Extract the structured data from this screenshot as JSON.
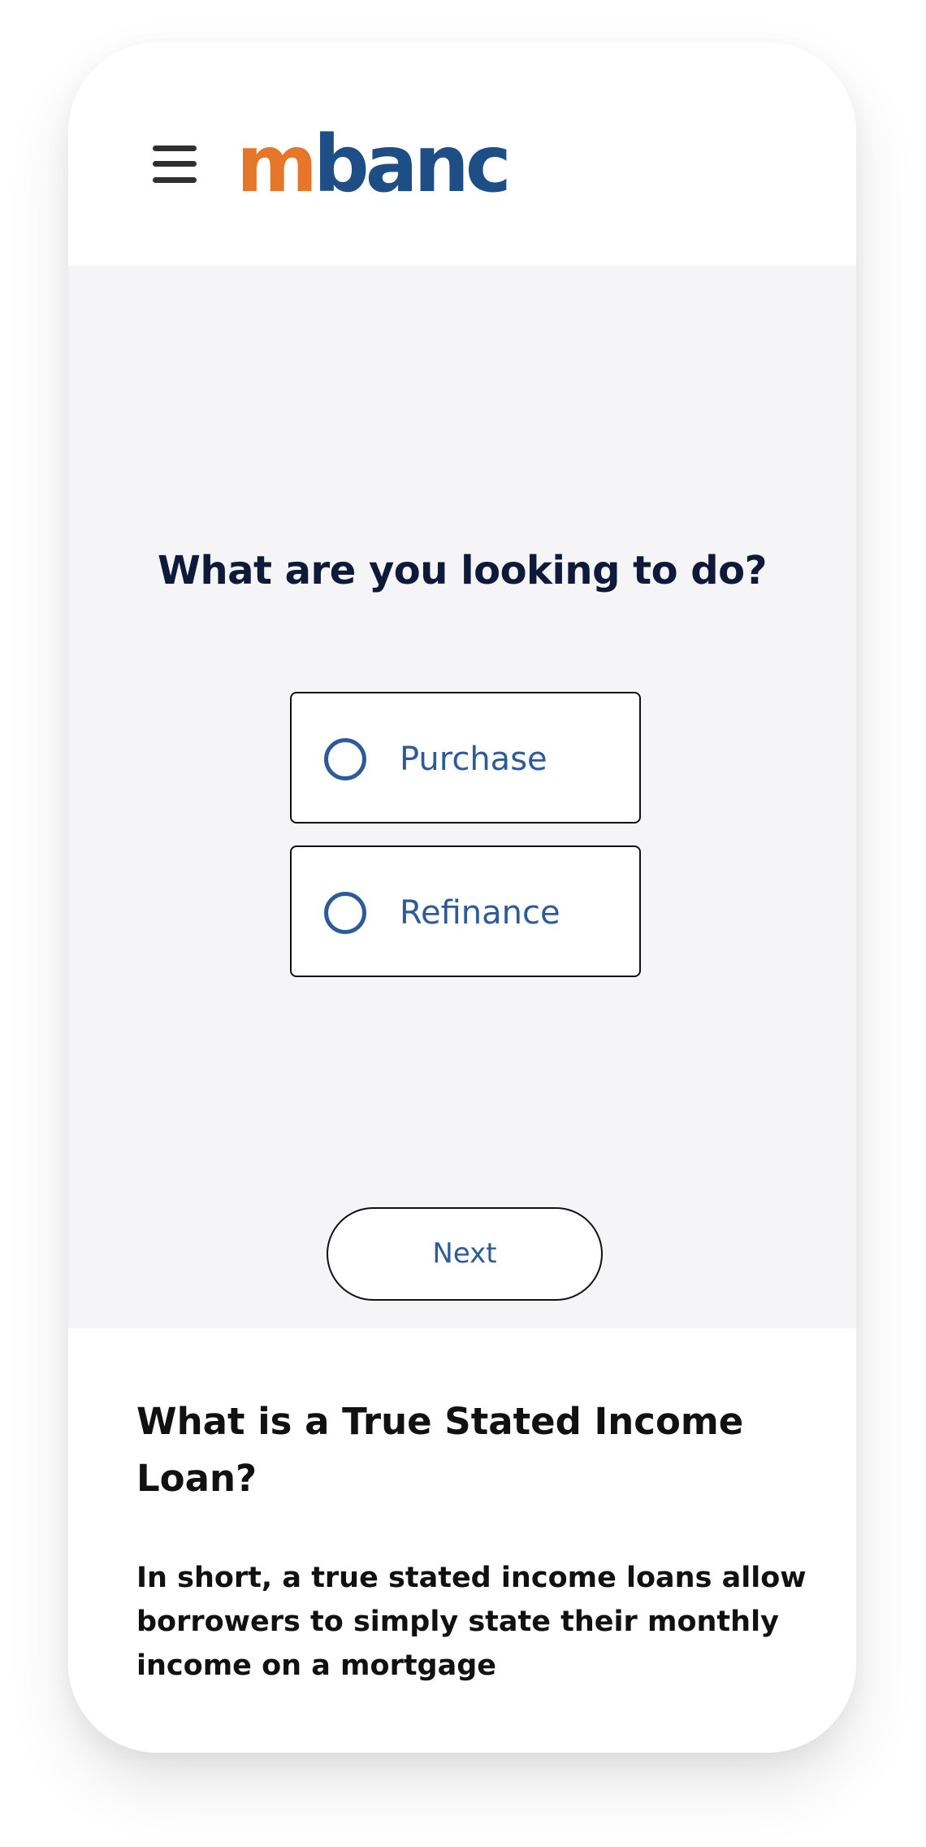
{
  "header": {
    "menu_icon": "hamburger-menu-icon",
    "logo": {
      "part1": "m",
      "part2": "banc",
      "colors": {
        "m": "#e5762a",
        "banc": "#1d4e86"
      }
    }
  },
  "form": {
    "question": "What are you looking to do?",
    "options": [
      {
        "label": "Purchase",
        "selected": false
      },
      {
        "label": "Refinance",
        "selected": false
      }
    ],
    "next_label": "Next"
  },
  "info": {
    "title": "What is a True Stated Income Loan?",
    "text": "In short, a true stated income loans allow borrowers to simply state their monthly income on a mortgage"
  },
  "colors": {
    "accent_blue": "#2d5b9a",
    "heading": "#0f1a3a",
    "hero_bg": "#f5f5f7"
  }
}
